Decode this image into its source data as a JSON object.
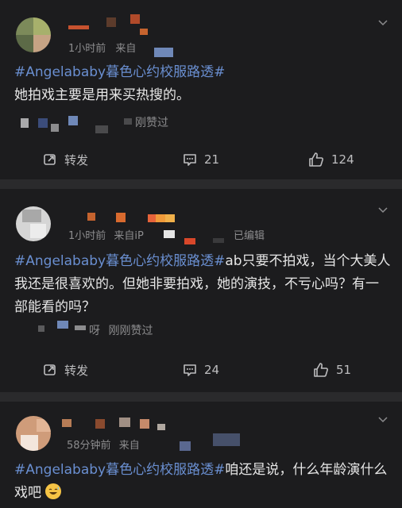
{
  "posts": [
    {
      "time": "1小时前",
      "source": "来自",
      "hashtag": "#Angelababy暮色心约校服路透#",
      "text": "她拍戏主要是用来买热搜的。",
      "liked_text": "刚赞过",
      "repost_label": "转发",
      "comment_count": "21",
      "like_count": "124"
    },
    {
      "time": "1小时前",
      "source": "来自iP",
      "edited": "已编辑",
      "hashtag": "#Angelababy暮色心约校服路透#",
      "text": "ab只要不拍戏，当个大美人我还是很喜欢的。但她非要拍戏，她的演技，不亏心吗？有一部能看的吗？",
      "liked_user_partial": "呀",
      "liked_text": "刚刚赞过",
      "repost_label": "转发",
      "comment_count": "24",
      "like_count": "51"
    },
    {
      "time": "58分钟前",
      "source": "来自",
      "hashtag": "#Angelababy暮色心约校服路透#",
      "text": "咱还是说，什么年龄演什么戏吧",
      "emoji_icon": "grinning-sweat-emoji"
    }
  ],
  "colors": {
    "background": "#1c1c1e",
    "separator": "#2a2a2c",
    "hashtag": "#6a8fd1",
    "text": "#e6e6e6",
    "meta": "#8c8c8e"
  },
  "icons": [
    "repost-icon",
    "comment-icon",
    "like-thumb-icon",
    "chevron-down-icon"
  ]
}
